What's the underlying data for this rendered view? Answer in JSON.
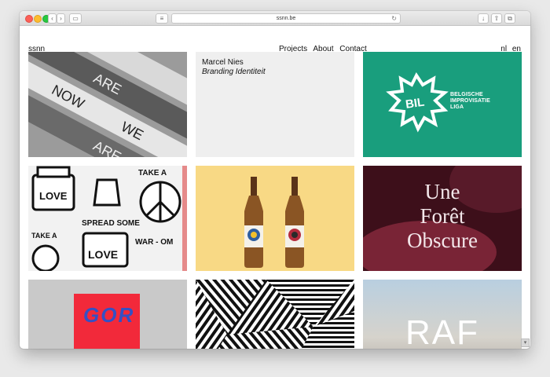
{
  "browser": {
    "url": "ssnn.be"
  },
  "site": {
    "logo": "ssnn",
    "nav": [
      "Projects",
      "About",
      "Contact"
    ],
    "languages": [
      "nl",
      "en"
    ]
  },
  "tiles": [
    {
      "name": "we-are-now-signage",
      "words": [
        "WE",
        "ARE",
        "NOW",
        "ARE",
        "WE"
      ]
    },
    {
      "name": "marcel-nies",
      "title": "Marcel Nies",
      "subtitle": "Branding Identiteit"
    },
    {
      "name": "bil",
      "logo_text": "BIL",
      "lines": [
        "BELGISCHE",
        "IMPROVISATIE",
        "LIGA"
      ]
    },
    {
      "name": "love-spread",
      "words": [
        "LOVE",
        "SPREAD SOME",
        "TAKE A",
        "WAR - OM",
        "LOVE",
        "TAKE A"
      ]
    },
    {
      "name": "beer-bottles"
    },
    {
      "name": "une-foret-obscure",
      "lines": [
        "Une",
        "Forêt",
        "Obscure"
      ]
    },
    {
      "name": "red-poster",
      "letters": "GOR"
    },
    {
      "name": "geometric-pattern"
    },
    {
      "name": "raf",
      "text": "RAF"
    }
  ]
}
